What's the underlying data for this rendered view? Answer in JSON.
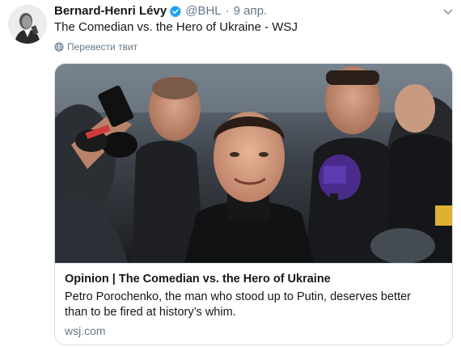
{
  "tweet": {
    "author_name": "Bernard-Henri Lévy",
    "handle": "@BHL",
    "separator": "·",
    "time": "9 апр.",
    "text": "The Comedian vs. the Hero of Ukraine - WSJ",
    "translate_label": "Перевести твит",
    "verified": true
  },
  "card": {
    "title": "Opinion | The Comedian vs. the Hero of Ukraine",
    "description": "Petro Porochenko, the man who stood up to Putin, deserves better than to be fired at history’s whim.",
    "domain": "wsj.com",
    "image_icon": "news-photo-crowd"
  },
  "icons": {
    "verified": "verified-badge-icon",
    "caret": "chevron-down-icon",
    "translate": "globe-icon"
  },
  "colors": {
    "verified_blue": "#1da1f2",
    "secondary_text": "#657786",
    "border": "#d7dee3"
  }
}
